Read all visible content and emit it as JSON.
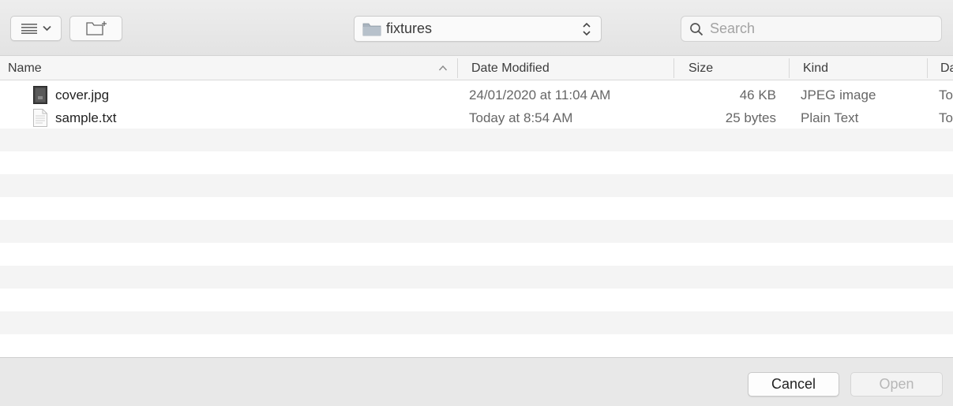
{
  "toolbar": {
    "view_icon": "list-view-icon",
    "view_menu_icon": "chevron-down-icon",
    "new_folder_icon": "new-folder-icon",
    "location": "fixtures",
    "location_icon": "folder-icon",
    "search_placeholder": "Search"
  },
  "columns": {
    "name": "Name",
    "date_modified": "Date Modified",
    "size": "Size",
    "kind": "Kind",
    "date_added": "Da"
  },
  "sort": {
    "column": "Name",
    "direction": "ascending"
  },
  "files": [
    {
      "name": "cover.jpg",
      "icon": "image-file-icon",
      "date_modified": "24/01/2020 at 11:04 AM",
      "size": "46 KB",
      "kind": "JPEG image",
      "date_added": "To"
    },
    {
      "name": "sample.txt",
      "icon": "text-file-icon",
      "date_modified": "Today at 8:54 AM",
      "size": "25 bytes",
      "kind": "Plain Text",
      "date_added": "To"
    }
  ],
  "footer": {
    "cancel_label": "Cancel",
    "open_label": "Open"
  },
  "colors": {
    "stripe": "#f4f4f4",
    "toolbar": "#e6e6e6",
    "disabled_text": "#b7b7b7"
  }
}
